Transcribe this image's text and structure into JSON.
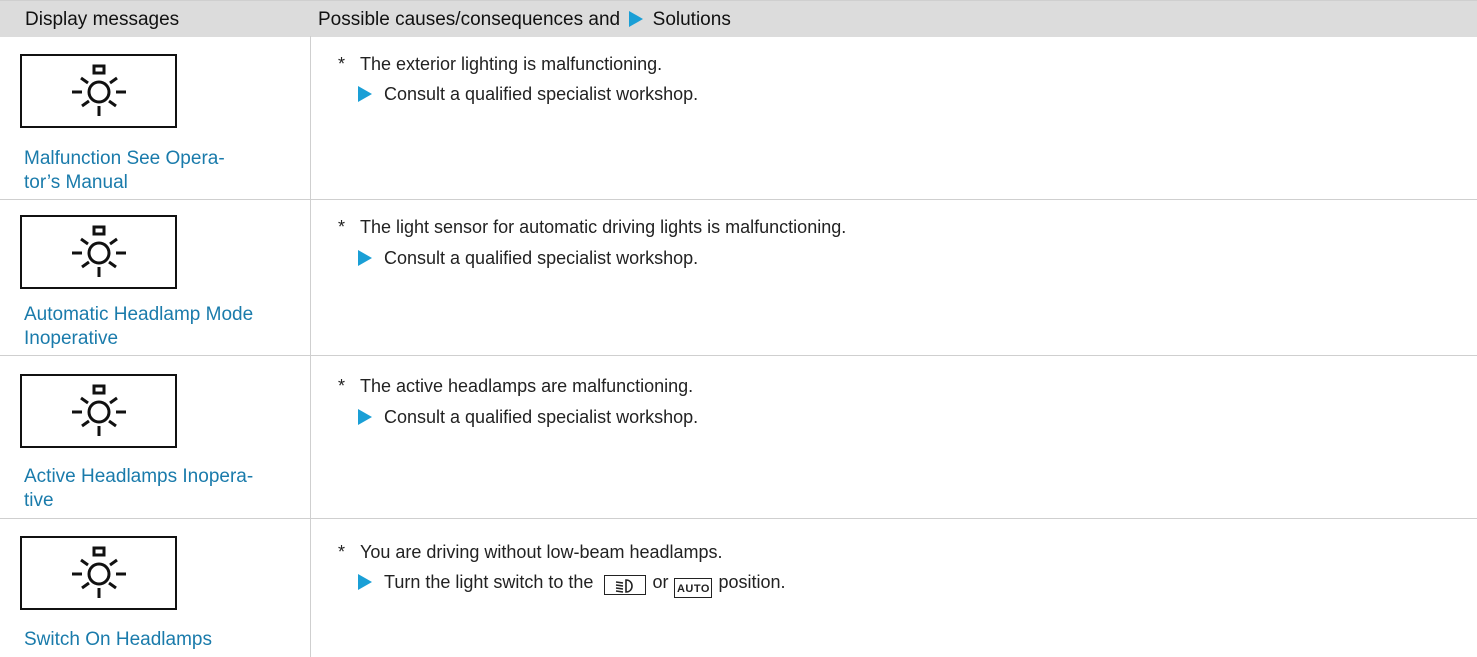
{
  "header": {
    "col1": "Display messages",
    "col2_prefix": "Possible causes/consequences and",
    "col2_suffix": "Solutions"
  },
  "icon": "exterior-light-bulb-icon",
  "colors": {
    "link": "#1a7bab",
    "accent": "#1a9fd6",
    "header_bg": "#dcdcdc"
  },
  "rows": [
    {
      "label_line1": "Malfunction See Opera-",
      "label_line2": "tor’s Manual",
      "cause": "The exterior lighting is malfunctioning.",
      "solution": "Consult a qualified specialist workshop."
    },
    {
      "label_line1": "Automatic Headlamp Mode",
      "label_line2": "Inoperative",
      "cause": "The light sensor for automatic driving lights is malfunctioning.",
      "solution": "Consult a qualified specialist workshop."
    },
    {
      "label_line1": "Active Headlamps Inopera-",
      "label_line2": "tive",
      "cause": "The active headlamps are malfunctioning.",
      "solution": "Consult a qualified specialist workshop."
    },
    {
      "label_line1": "Switch On Headlamps",
      "cause": "You are driving without low-beam headlamps.",
      "solution_prefix": "Turn the light switch to the",
      "solution_or": "or",
      "solution_suffix": "position.",
      "key_auto": "AUTO",
      "key_light_icon": "low-beam-headlamp-icon"
    }
  ]
}
